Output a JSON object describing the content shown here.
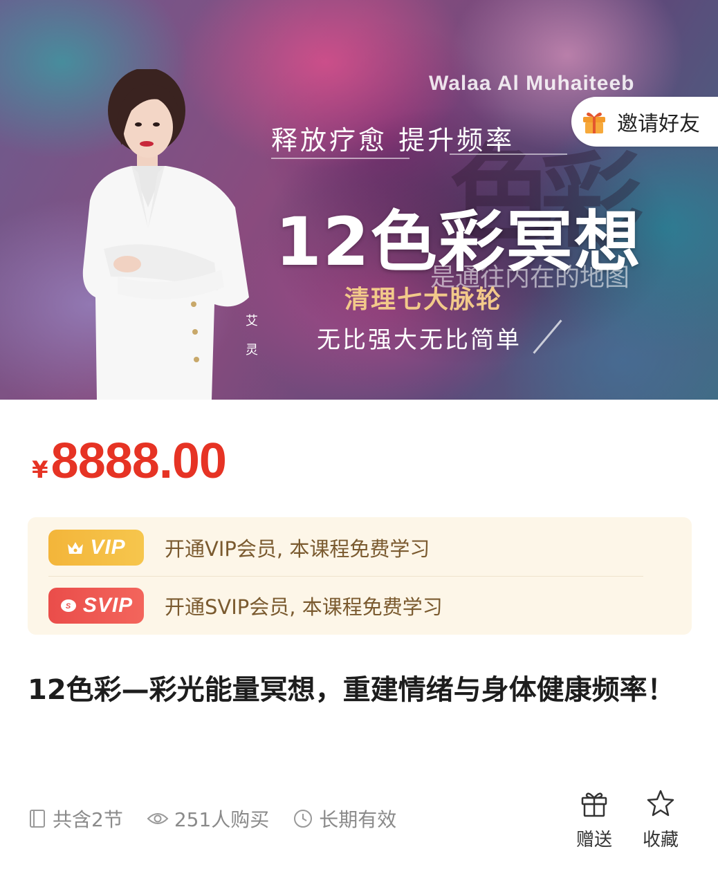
{
  "banner": {
    "author_en": "Walaa Al Muhaiteeb",
    "slogan": "释放疗愈 提升频率",
    "title": "12色彩冥想",
    "subtitle": "是通往内在的地图",
    "gold_text": "清理七大脉轮",
    "tagline": "无比强大无比简单",
    "deco_chars": [
      "色",
      "彩"
    ],
    "name_chars": [
      "艾",
      "灵"
    ]
  },
  "invite": {
    "label": "邀请好友",
    "icon": "gift-icon",
    "color": "#f39a2b"
  },
  "price": {
    "currency": "¥",
    "value": "8888.00",
    "color": "#e63324"
  },
  "membership": [
    {
      "badge": "VIP",
      "text": "开通VIP会员, 本课程免费学习",
      "color": "#f3b53a",
      "icon": "crown-icon"
    },
    {
      "badge": "SVIP",
      "text": "开通SVIP会员, 本课程免费学习",
      "color": "#ea4d4a",
      "icon": "diamond-icon"
    }
  ],
  "course": {
    "title": "12色彩—彩光能量冥想，重建情绪与身体健康频率！"
  },
  "meta": {
    "lessons": "共含2节",
    "buyers": "251人购买",
    "validity": "长期有效"
  },
  "actions": {
    "gift": "赠送",
    "favorite": "收藏"
  }
}
